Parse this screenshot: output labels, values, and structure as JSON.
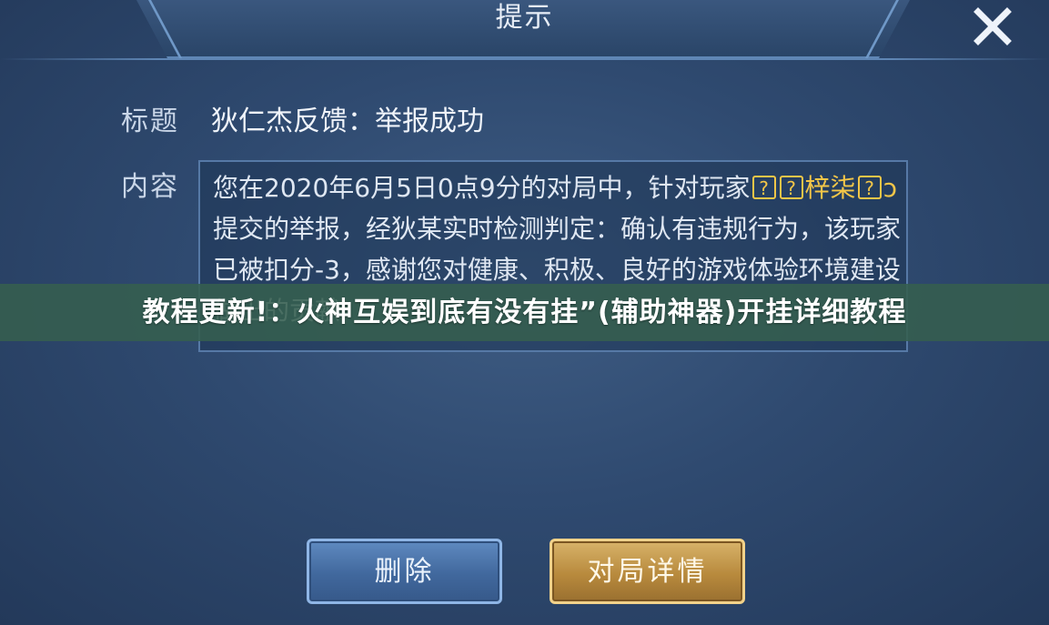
{
  "dialog": {
    "title": "提示",
    "close_icon": "close-icon"
  },
  "fields": {
    "title_label": "标题",
    "title_value": "狄仁杰反馈：举报成功",
    "content_label": "内容",
    "content": {
      "part1": "您在2020年6月5日0点9分的对局中，针对玩家",
      "player_name_a": "梓",
      "player_name_b": "柒",
      "player_suffix": "ↄ",
      "part2": "提交的举报，经狄某实时检测判定：确认有违规行为，该玩家已被扣分-3，感谢您对健康、积极、良好的游戏体验环境建设做出的贡献"
    }
  },
  "banner": {
    "text": "教程更新!：火神互娱到底有没有挂”(辅助神器)开挂详细教程"
  },
  "buttons": {
    "delete": "删除",
    "detail": "对局详情"
  },
  "colors": {
    "highlight": "#f3c648",
    "delete_button": "#41689d",
    "detail_button": "#b88a3d",
    "banner": "#365e4e"
  }
}
